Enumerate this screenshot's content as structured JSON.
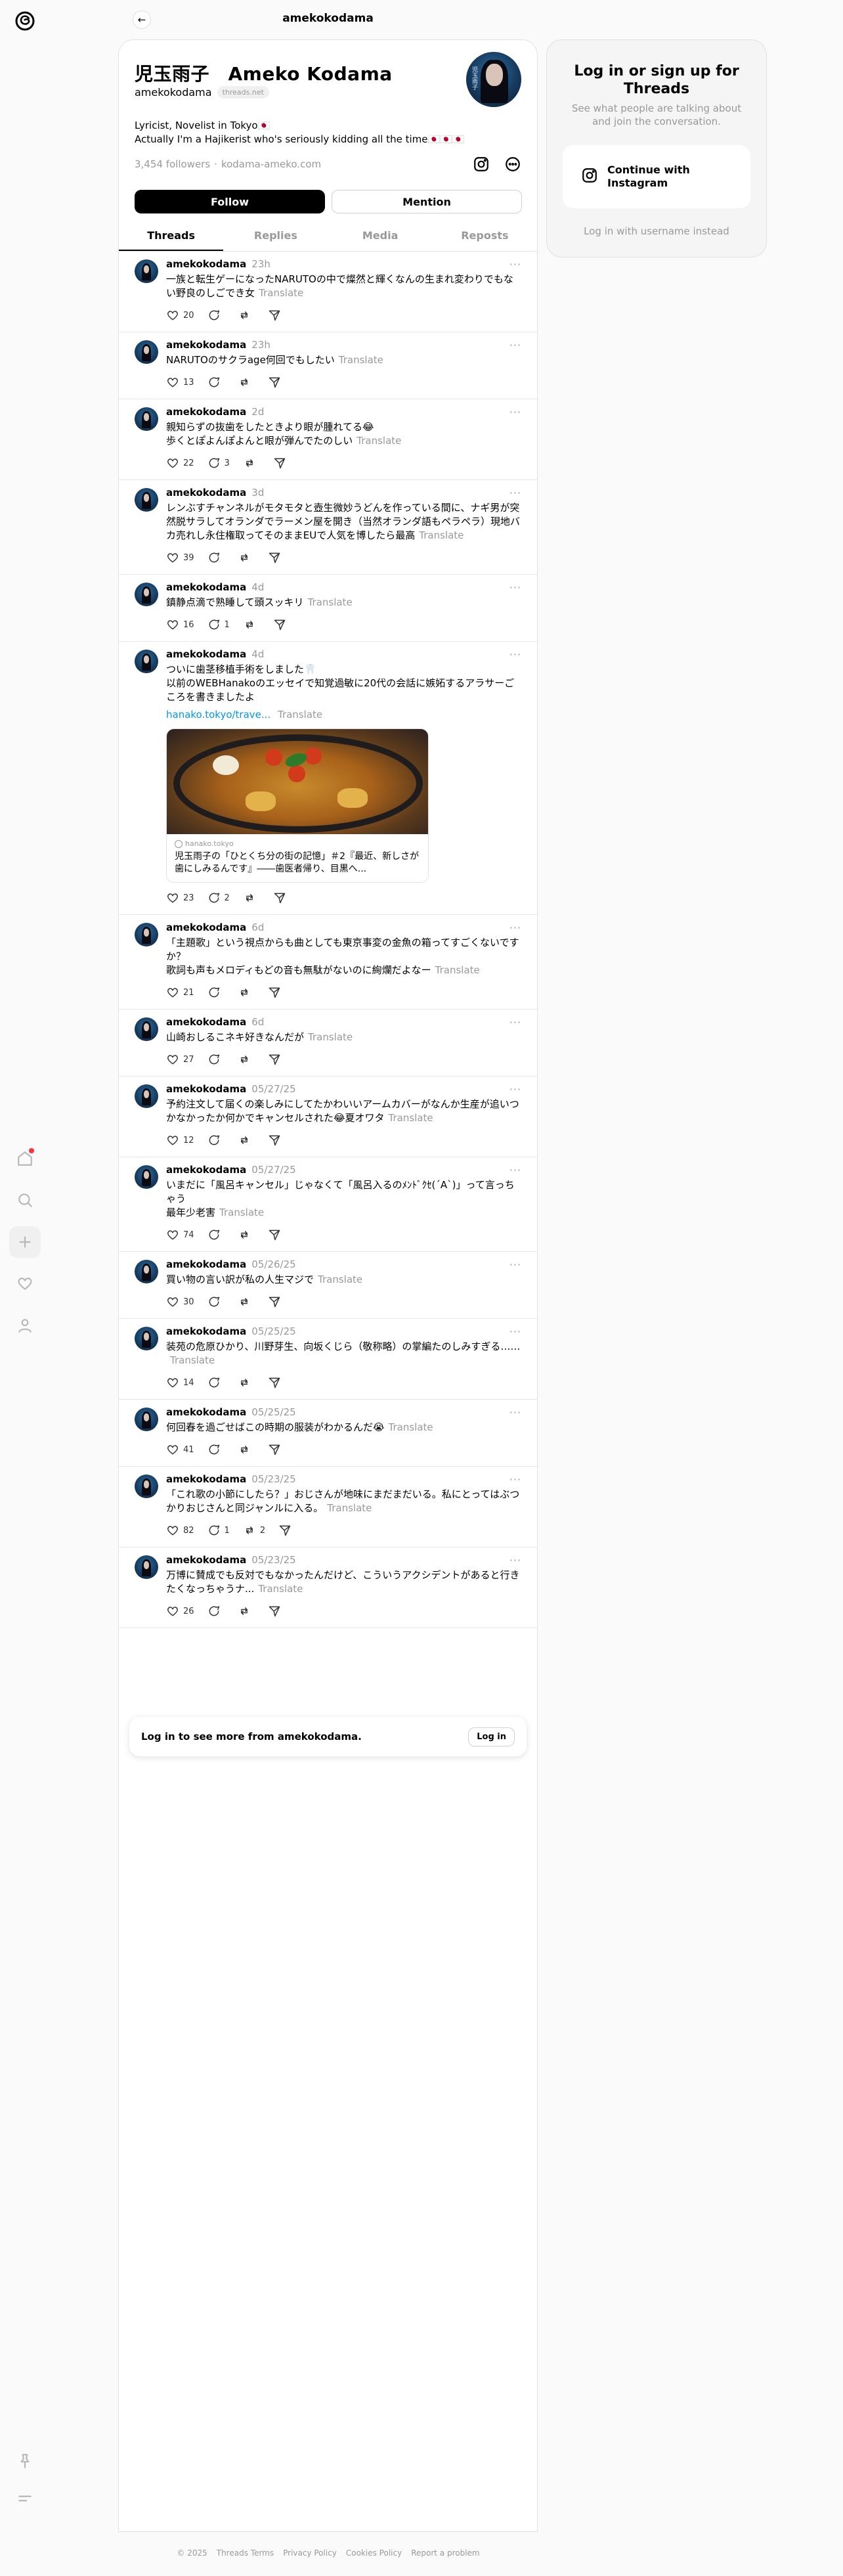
{
  "nav": {
    "title": "amekokodama"
  },
  "profile": {
    "display_name": "児玉雨子　Ameko Kodama",
    "handle": "amekokodama",
    "domain_pill": "threads.net",
    "bio_line1": "Lyricist, Novelist in Tokyo🇯🇵",
    "bio_line2": "Actually I'm a Hajikerist who's seriously kidding all the time🇯🇵🇯🇵🇯🇵",
    "followers": "3,454 followers",
    "separator": "·",
    "website": "kodama-ameko.com",
    "follow_label": "Follow",
    "mention_label": "Mention"
  },
  "tabs": [
    {
      "label": "Threads"
    },
    {
      "label": "Replies"
    },
    {
      "label": "Media"
    },
    {
      "label": "Reposts"
    }
  ],
  "translate_label": "Translate",
  "more_label": "···",
  "posts": [
    {
      "user": "amekokodama",
      "time": "23h",
      "text": "一族と転生ゲーになったNARUTOの中で燦然と輝くなんの生まれ変わりでもない野良のしごでき女",
      "likes": "20",
      "replies": "",
      "reposts": ""
    },
    {
      "user": "amekokodama",
      "time": "23h",
      "text": "NARUTOのサクラage何回でもしたい",
      "likes": "13",
      "replies": "",
      "reposts": ""
    },
    {
      "user": "amekokodama",
      "time": "2d",
      "text": "親知らずの抜歯をしたときより眼が腫れてる😂\n歩くとぽよんぽよんと眼が弾んでたのしい",
      "likes": "22",
      "replies": "3",
      "reposts": ""
    },
    {
      "user": "amekokodama",
      "time": "3d",
      "text": "レンぶすチャンネルがモタモタと壺生微妙うどんを作っている間に、ナギ男が突然脱サラしてオランダでラーメン屋を開き（当然オランダ語もペラペラ）現地バカ売れし永住権取ってそのままEUで人気を博したら最高",
      "likes": "39",
      "replies": "",
      "reposts": ""
    },
    {
      "user": "amekokodama",
      "time": "4d",
      "text": "鎮静点滴で熟睡して頭スッキリ",
      "likes": "16",
      "replies": "1",
      "reposts": ""
    },
    {
      "user": "amekokodama",
      "time": "4d",
      "text": "ついに歯茎移植手術をしました🦷\n以前のWEBHanakoのエッセイで知覚過敏に20代の会話に嫉妬するアラサーごころを書きましたよ",
      "link": "hanako.tokyo/trave...",
      "card_source": "hanako.tokyo",
      "card_title": "児玉雨子の「ひとくち分の街の記憶」＃2『最近、新しさが歯にしみるんです』――歯医者帰り、目黒へ...",
      "likes": "23",
      "replies": "2",
      "reposts": ""
    },
    {
      "user": "amekokodama",
      "time": "6d",
      "text": "「主題歌」という視点からも曲としても東京事変の金魚の箱ってすごくないですか？\n歌詞も声もメロディもどの音も無駄がないのに絢爛だよなー",
      "likes": "21",
      "replies": "",
      "reposts": ""
    },
    {
      "user": "amekokodama",
      "time": "6d",
      "text": "山崎おしるこネキ好きなんだが",
      "likes": "27",
      "replies": "",
      "reposts": ""
    },
    {
      "user": "amekokodama",
      "time": "05/27/25",
      "text": "予約注文して届くの楽しみにしてたかわいいアームカバーがなんか生産が追いつかなかったか何かでキャンセルされた😂夏オワタ",
      "likes": "12",
      "replies": "",
      "reposts": ""
    },
    {
      "user": "amekokodama",
      "time": "05/27/25",
      "text": "いまだに「風呂キャンセル」じゃなくて「風呂入るのﾒﾝﾄﾞｸｾ(´A`)」って言っちゃう\n最年少老害",
      "likes": "74",
      "replies": "",
      "reposts": ""
    },
    {
      "user": "amekokodama",
      "time": "05/26/25",
      "text": "買い物の言い訳が私の人生マジで",
      "likes": "30",
      "replies": "",
      "reposts": ""
    },
    {
      "user": "amekokodama",
      "time": "05/25/25",
      "text": "装苑の危原ひかり、川野芽生、向坂くじら（敬称略）の掌編たのしみすぎる……",
      "likes": "14",
      "replies": "",
      "reposts": ""
    },
    {
      "user": "amekokodama",
      "time": "05/25/25",
      "text": "何回春を過ごせばこの時期の服装がわかるんだ😭",
      "likes": "41",
      "replies": "",
      "reposts": ""
    },
    {
      "user": "amekokodama",
      "time": "05/23/25",
      "text": "「これ歌の小節にしたら？」おじさんが地味にまだまだいる。私にとってはぶつかりおじさんと同ジャンルに入る。",
      "likes": "82",
      "replies": "1",
      "reposts": "2"
    },
    {
      "user": "amekokodama",
      "time": "05/23/25",
      "text": "万博に賛成でも反対でもなかったんだけど、こういうアクシデントがあると行きたくなっちゃうナ...",
      "likes": "26",
      "replies": "",
      "reposts": ""
    }
  ],
  "login_more": {
    "text": "Log in to see more from amekokodama.",
    "button": "Log in"
  },
  "sidebar": {
    "title": "Log in or sign up for Threads",
    "subtitle": "See what people are talking about and join the conversation.",
    "instagram_label": "Continue with Instagram",
    "alt_login": "Log in with username instead"
  },
  "footer": {
    "copyright": "© 2025",
    "terms": "Threads Terms",
    "privacy": "Privacy Policy",
    "cookies": "Cookies Policy",
    "report": "Report a problem"
  }
}
